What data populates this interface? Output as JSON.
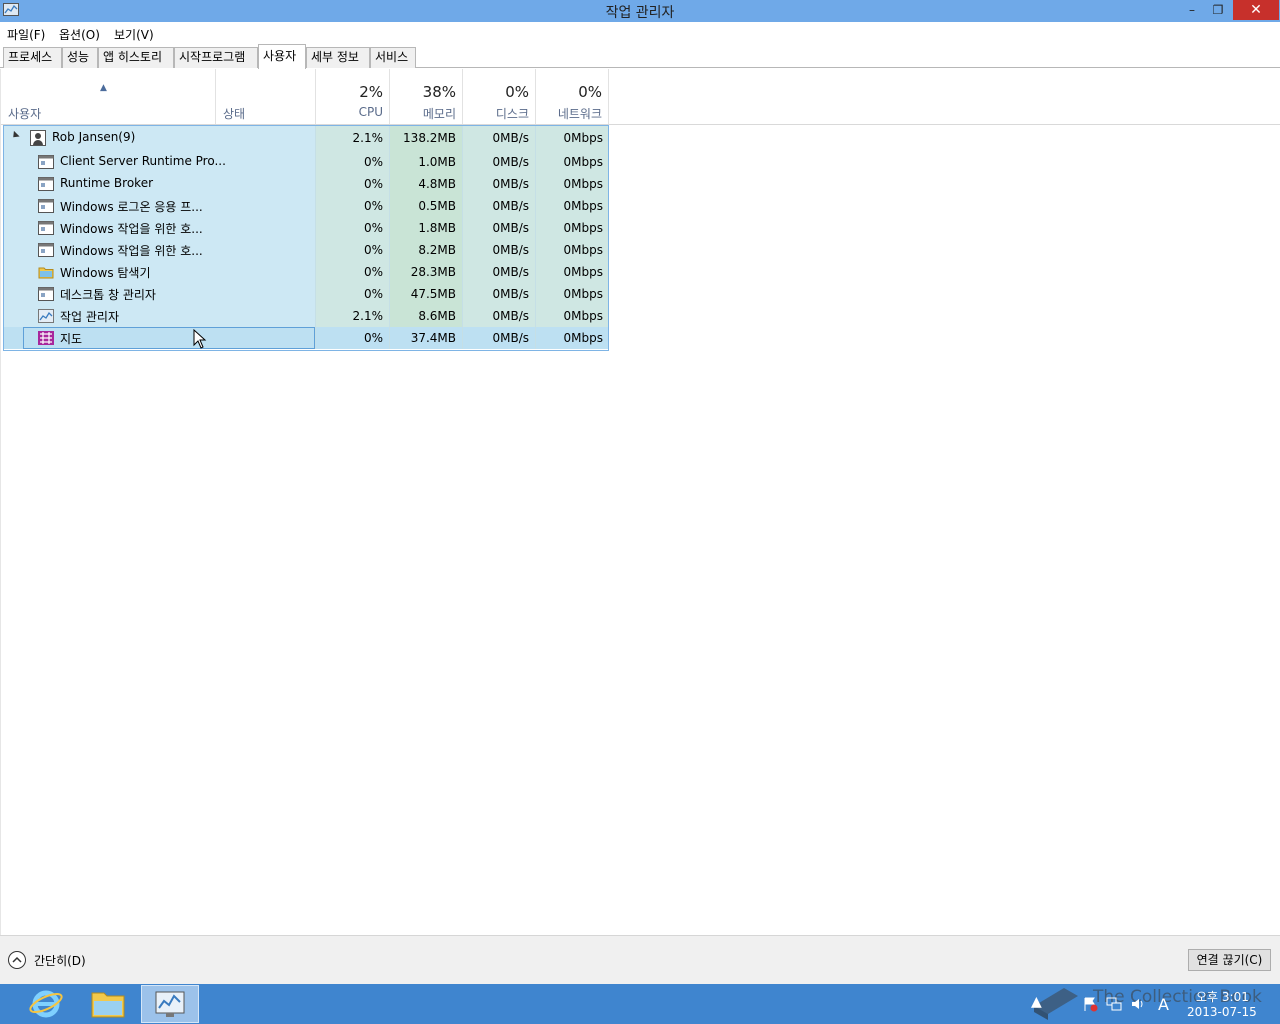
{
  "window": {
    "title": "작업 관리자",
    "minimize": "–",
    "maximize": "❐",
    "close": "✕"
  },
  "menu": [
    {
      "label": "파일(F)"
    },
    {
      "label": "옵션(O)"
    },
    {
      "label": "보기(V)"
    }
  ],
  "tabs": [
    {
      "label": "프로세스"
    },
    {
      "label": "성능"
    },
    {
      "label": "앱 히스토리"
    },
    {
      "label": "시작프로그램"
    },
    {
      "label": "사용자"
    },
    {
      "label": "세부 정보"
    },
    {
      "label": "서비스"
    }
  ],
  "columns": {
    "user": "사용자",
    "status": "상태",
    "cpu": {
      "pct": "2%",
      "label": "CPU"
    },
    "memory": {
      "pct": "38%",
      "label": "메모리"
    },
    "disk": {
      "pct": "0%",
      "label": "디스크"
    },
    "network": {
      "pct": "0%",
      "label": "네트워크"
    }
  },
  "user_group": {
    "name": "Rob Jansen(9)",
    "cpu": "2.1%",
    "memory": "138.2MB",
    "disk": "0MB/s",
    "network": "0Mbps"
  },
  "processes": [
    {
      "name": "Client Server Runtime Pro...",
      "icon": "window-app-icon",
      "cpu": "0%",
      "memory": "1.0MB",
      "disk": "0MB/s",
      "network": "0Mbps"
    },
    {
      "name": "Runtime Broker",
      "icon": "window-app-icon",
      "cpu": "0%",
      "memory": "4.8MB",
      "disk": "0MB/s",
      "network": "0Mbps"
    },
    {
      "name": "Windows 로그온 응용 프...",
      "icon": "window-app-icon",
      "cpu": "0%",
      "memory": "0.5MB",
      "disk": "0MB/s",
      "network": "0Mbps"
    },
    {
      "name": "Windows 작업을 위한 호...",
      "icon": "window-app-icon",
      "cpu": "0%",
      "memory": "1.8MB",
      "disk": "0MB/s",
      "network": "0Mbps"
    },
    {
      "name": "Windows 작업을 위한 호...",
      "icon": "window-app-icon",
      "cpu": "0%",
      "memory": "8.2MB",
      "disk": "0MB/s",
      "network": "0Mbps"
    },
    {
      "name": "Windows 탐색기",
      "icon": "folder-icon",
      "cpu": "0%",
      "memory": "28.3MB",
      "disk": "0MB/s",
      "network": "0Mbps"
    },
    {
      "name": "데스크톱 창 관리자",
      "icon": "window-app-icon",
      "cpu": "0%",
      "memory": "47.5MB",
      "disk": "0MB/s",
      "network": "0Mbps"
    },
    {
      "name": "작업 관리자",
      "icon": "task-manager-icon",
      "cpu": "2.1%",
      "memory": "8.6MB",
      "disk": "0MB/s",
      "network": "0Mbps"
    },
    {
      "name": "지도",
      "icon": "maps-icon",
      "cpu": "0%",
      "memory": "37.4MB",
      "disk": "0MB/s",
      "network": "0Mbps"
    }
  ],
  "footer": {
    "collapse": "간단히(D)",
    "disconnect": "연결 끊기(C)"
  },
  "taskbar": {
    "clock_time": "오후 3:01",
    "clock_date": "2013-07-15",
    "ime": "A",
    "watermark": "The Collection Book"
  },
  "colors": {
    "titlebar": "#6fa9e8",
    "taskbar": "#3f85cf",
    "row_highlight": "#cde8f4",
    "close_button": "#c7302b"
  }
}
